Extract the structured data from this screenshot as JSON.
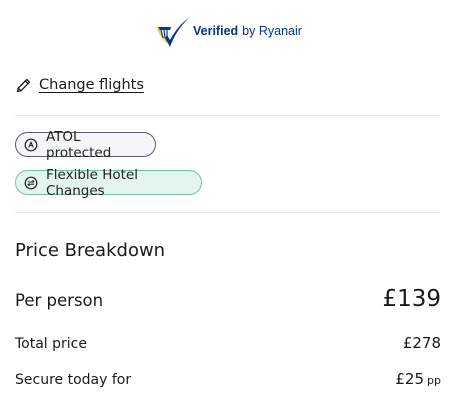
{
  "verified": {
    "bold_text": "Verified",
    "by_text": "by Ryanair",
    "logo_icon": "ryanair-harp-check-icon",
    "brand_color": "#073590"
  },
  "change_flights": {
    "icon": "pencil-icon",
    "label": "Change flights"
  },
  "badges": {
    "atol": {
      "icon": "atol-icon",
      "label": "ATOL protected"
    },
    "flexible": {
      "icon": "exchange-icon",
      "label": "Flexible Hotel Changes",
      "background": "#e4f5ee",
      "border": "#79c3a3"
    }
  },
  "price_breakdown": {
    "title": "Price Breakdown",
    "per_person": {
      "label": "Per person",
      "value": "£139"
    },
    "total": {
      "label": "Total price",
      "value": "£278"
    },
    "secure_today": {
      "label": "Secure today for",
      "value": "£25",
      "suffix": "pp"
    }
  }
}
